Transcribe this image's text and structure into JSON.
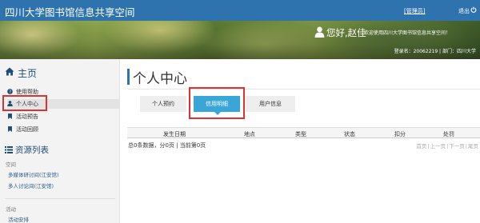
{
  "header": {
    "brand": "四川大学图书馆信息共享空间",
    "admin_link": "[管理员]",
    "logout_label": "退出",
    "greeting": "您好,赵佳",
    "welcome_text": "欢迎使用四川大学图书馆信息共享空间！",
    "login_info": "登录名：20062219 | 部门：四川大学"
  },
  "sidebar": {
    "home_title": "主页",
    "menu": [
      {
        "label": "使用帮助",
        "icon": "question-circle-icon"
      },
      {
        "label": "个人中心",
        "icon": "user-icon"
      },
      {
        "label": "活动预告",
        "icon": "bookmark-icon"
      },
      {
        "label": "活动回顾",
        "icon": "bookmark-icon"
      }
    ],
    "resource_title": "资源列表",
    "space_label": "空间",
    "space_links": [
      "多媒体研讨间(江安馆)",
      "多人讨论间(江安馆)"
    ],
    "activity_label": "活动",
    "activity_links": [
      "活动安排"
    ]
  },
  "main": {
    "page_title": "个人中心",
    "tabs": [
      {
        "label": "个人预约",
        "active": false
      },
      {
        "label": "信用明细",
        "active": true
      },
      {
        "label": "用户信息",
        "active": false
      }
    ],
    "columns": [
      "发生日期",
      "地点",
      "类型",
      "状态",
      "扣分",
      "处罚"
    ],
    "pager_info": "总0条数据，分0页 | 当前第0页",
    "pager_nav": [
      "首页",
      "上一页",
      "下一页",
      "尾页"
    ]
  },
  "colors": {
    "topbar": "#2e73ad",
    "active_tab": "#3aa6d8",
    "highlight": "#e03030"
  }
}
